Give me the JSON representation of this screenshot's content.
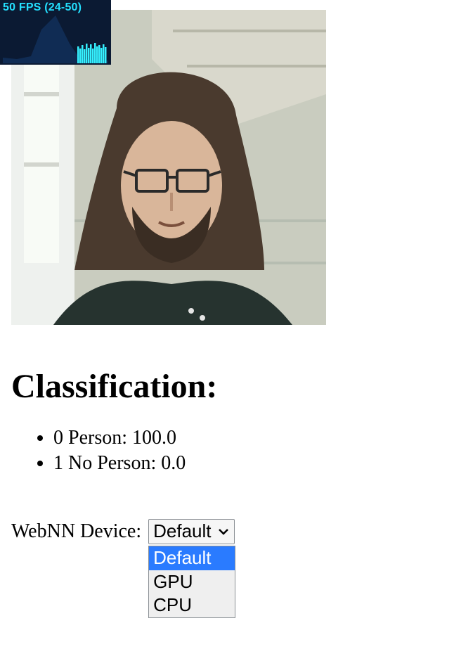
{
  "fps": {
    "text": "50 FPS (24-50)"
  },
  "heading": "Classification:",
  "results": [
    {
      "label": "0 Person: 100.0"
    },
    {
      "label": "1 No Person: 0.0"
    }
  ],
  "device": {
    "label": "WebNN Device: ",
    "selected": "Default",
    "options": [
      "Default",
      "GPU",
      "CPU"
    ]
  },
  "colors": {
    "fps_bg": "#0b1a33",
    "fps_text": "#24e0ff",
    "fps_bar": "#35f0ff",
    "select_highlight": "#2a7bff"
  }
}
